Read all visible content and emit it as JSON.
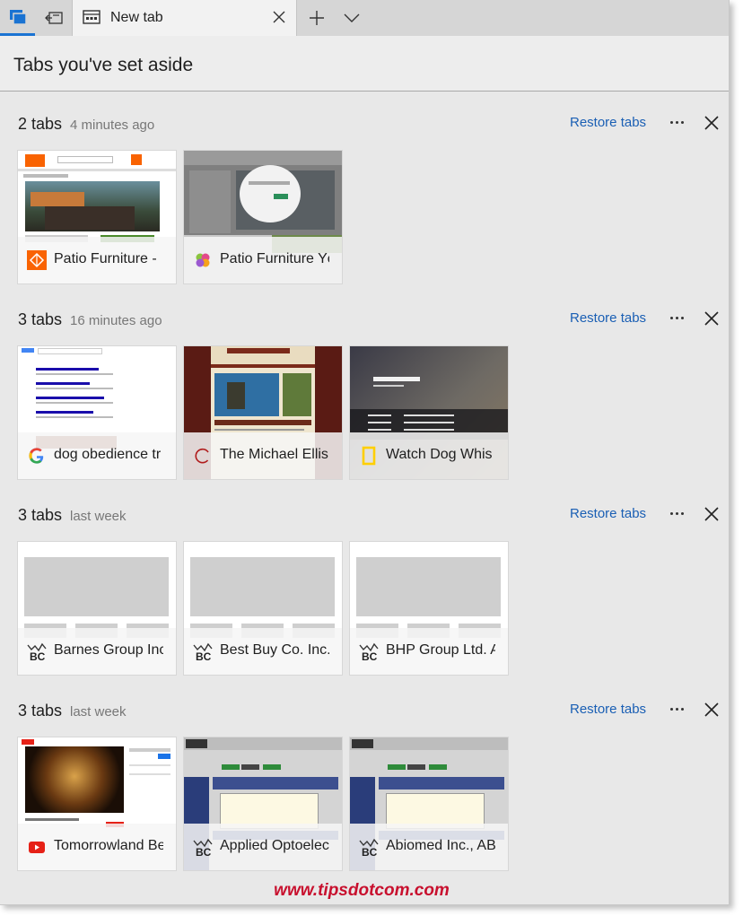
{
  "tabstrip": {
    "tab_label": "New tab",
    "icons": [
      "tabs-aside-icon",
      "set-aside-icon",
      "tab-page-icon",
      "close-icon",
      "plus-icon",
      "chevron-down-icon"
    ]
  },
  "panel": {
    "title": "Tabs you've set aside"
  },
  "groups": [
    {
      "count": "2 tabs",
      "time": "4 minutes ago",
      "restore": "Restore tabs",
      "cards": [
        {
          "title": "Patio Furniture -",
          "favicon": "home-depot-icon"
        },
        {
          "title": "Patio Furniture Yc",
          "favicon": "pinwheel-icon"
        }
      ]
    },
    {
      "count": "3 tabs",
      "time": "16 minutes ago",
      "restore": "Restore tabs",
      "cards": [
        {
          "title": "dog obedience tr",
          "favicon": "google-icon"
        },
        {
          "title": "The Michael Ellis",
          "favicon": "loading-spinner-icon"
        },
        {
          "title": "Watch Dog Whis",
          "favicon": "nat-geo-icon"
        }
      ]
    },
    {
      "count": "3 tabs",
      "time": "last week",
      "restore": "Restore tabs",
      "cards": [
        {
          "title": "Barnes Group Inc",
          "favicon": "bc-chart-icon"
        },
        {
          "title": "Best Buy Co. Inc.,",
          "favicon": "bc-chart-icon"
        },
        {
          "title": "BHP Group Ltd. A",
          "favicon": "bc-chart-icon"
        }
      ]
    },
    {
      "count": "3 tabs",
      "time": "last week",
      "restore": "Restore tabs",
      "cards": [
        {
          "title": "Tomorrowland Be",
          "favicon": "youtube-icon"
        },
        {
          "title": "Applied Optoelec",
          "favicon": "bc-chart-icon"
        },
        {
          "title": "Abiomed Inc., AB",
          "favicon": "bc-chart-icon"
        }
      ]
    }
  ],
  "watermark": "www.tipsdotcom.com",
  "colors": {
    "accent": "#1a73d2",
    "link": "#1a5fb4",
    "watermark": "#c8102e"
  }
}
